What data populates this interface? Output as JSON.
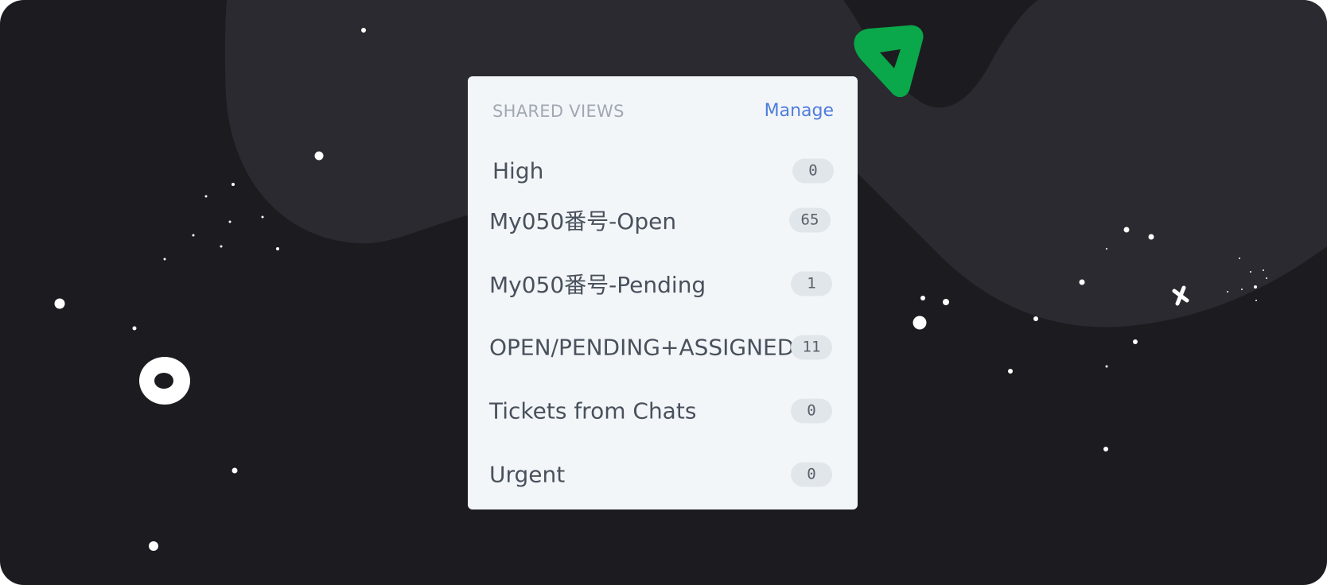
{
  "shared_views": {
    "title": "SHARED VIEWS",
    "manage_label": "Manage",
    "items": [
      {
        "label": "High",
        "count": "0"
      },
      {
        "label": "My050番号-Open",
        "count": "65"
      },
      {
        "label": "My050番号-Pending",
        "count": "1"
      },
      {
        "label": "OPEN/PENDING+ASSIGNED",
        "count": "11"
      },
      {
        "label": "Tickets from Chats",
        "count": "0"
      },
      {
        "label": "Urgent",
        "count": "0"
      }
    ]
  },
  "colors": {
    "background": "#1c1c20",
    "blob": "#2a2a30",
    "panel": "#f3f6f9",
    "accent_link": "#4f7ddb",
    "green_shape": "#0aa84a",
    "count_badge": "#e1e6ea"
  },
  "decorations": {
    "icons": [
      "green-triangle-icon",
      "white-ring-icon",
      "sparkle-cross-icon",
      "star-dot-icon"
    ]
  }
}
